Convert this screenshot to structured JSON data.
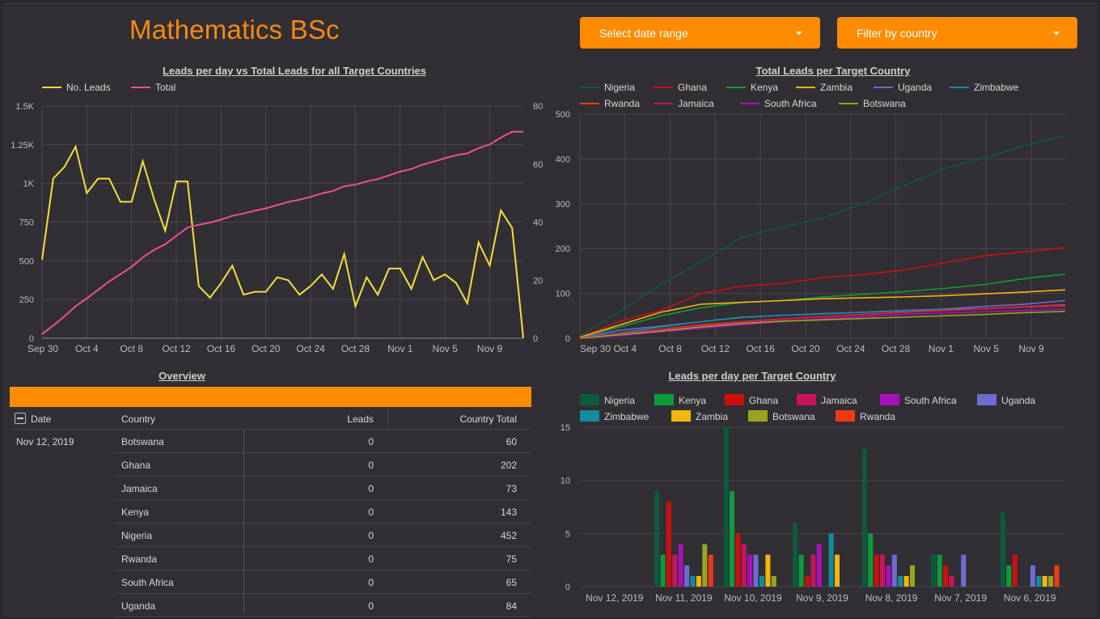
{
  "header": {
    "title": "Mathematics BSc"
  },
  "filters": {
    "date_range_label": "Select date range",
    "country_label": "Filter by country"
  },
  "colors": {
    "accent": "#ff8c00",
    "title": "#f58a12",
    "Nigeria": "#0b5b3f",
    "Ghana": "#cc1010",
    "Kenya": "#0e9b3a",
    "Zambia": "#f5b50f",
    "Uganda": "#6e6cd1",
    "Zimbabwe": "#138c9f",
    "Rwanda": "#f03a17",
    "Jamaica": "#c8145e",
    "South Africa": "#a513b8",
    "Botswana": "#9aa51e",
    "no_leads": "#f6de3b",
    "total": "#ef4f8f"
  },
  "chart_data": [
    {
      "type": "line",
      "title": "Leads per day vs Total Leads for all Target Countries",
      "x_tick_labels": [
        "Sep 30",
        "Oct 4",
        "Oct 8",
        "Oct 12",
        "Oct 16",
        "Oct 20",
        "Oct 24",
        "Oct 28",
        "Nov 1",
        "Nov 5",
        "Nov 9"
      ],
      "left_axis": {
        "ticks": [
          "0",
          "250",
          "500",
          "750",
          "1K",
          "1.25K",
          "1.5K"
        ],
        "range": [
          0,
          1500
        ]
      },
      "right_axis": {
        "ticks": [
          "0",
          "20",
          "40",
          "60",
          "80"
        ],
        "range": [
          0,
          80
        ]
      },
      "series": [
        {
          "name": "No. Leads",
          "axis": "right",
          "values": [
            27,
            55,
            59,
            66,
            50,
            55,
            55,
            47,
            47,
            61,
            48,
            37,
            54,
            54,
            18,
            14,
            19,
            25,
            15,
            16,
            16,
            21,
            20,
            15,
            18,
            22,
            17,
            29,
            11,
            21,
            15,
            24,
            24,
            17,
            28,
            20,
            22,
            19,
            12,
            33,
            25,
            44,
            38,
            0
          ]
        },
        {
          "name": "Total",
          "axis": "left",
          "values": [
            27,
            82,
            141,
            207,
            257,
            312,
            367,
            414,
            461,
            522,
            570,
            607,
            661,
            715,
            733,
            747,
            766,
            791,
            806,
            823,
            839,
            860,
            880,
            895,
            913,
            935,
            952,
            981,
            992,
            1013,
            1028,
            1052,
            1076,
            1093,
            1121,
            1141,
            1163,
            1182,
            1194,
            1227,
            1252,
            1296,
            1334,
            1334
          ]
        }
      ]
    },
    {
      "type": "line",
      "title": "Total Leads per Target Country",
      "x_tick_labels": [
        "Sep 30",
        "Oct 4",
        "Oct 8",
        "Oct 12",
        "Oct 16",
        "Oct 20",
        "Oct 24",
        "Oct 28",
        "Nov 1",
        "Nov 5",
        "Nov 9"
      ],
      "y_ticks": [
        "0",
        "100",
        "200",
        "300",
        "400",
        "500"
      ],
      "ylim": [
        0,
        500
      ],
      "legend": [
        "Nigeria",
        "Ghana",
        "Kenya",
        "Zambia",
        "Uganda",
        "Zimbabwe",
        "Rwanda",
        "Jamaica",
        "South Africa",
        "Botswana"
      ],
      "series": [
        {
          "name": "Nigeria",
          "values": [
            5,
            60,
            120,
            170,
            225,
            248,
            268,
            300,
            340,
            378,
            402,
            430,
            452
          ]
        },
        {
          "name": "Ghana",
          "values": [
            2,
            38,
            62,
            100,
            116,
            122,
            135,
            142,
            152,
            168,
            184,
            193,
            202
          ]
        },
        {
          "name": "Kenya",
          "values": [
            3,
            25,
            50,
            68,
            80,
            84,
            92,
            98,
            104,
            111,
            120,
            133,
            143
          ]
        },
        {
          "name": "Zambia",
          "values": [
            2,
            30,
            58,
            76,
            80,
            84,
            88,
            90,
            92,
            95,
            99,
            103,
            108
          ]
        },
        {
          "name": "Uganda",
          "values": [
            1,
            18,
            27,
            37,
            47,
            51,
            55,
            58,
            62,
            65,
            71,
            76,
            84
          ]
        },
        {
          "name": "Zimbabwe",
          "values": [
            1,
            12,
            25,
            37,
            46,
            51,
            54,
            58,
            61,
            64,
            66,
            69,
            72
          ]
        },
        {
          "name": "Rwanda",
          "values": [
            1,
            10,
            20,
            30,
            37,
            43,
            48,
            53,
            58,
            62,
            66,
            70,
            75
          ]
        },
        {
          "name": "Jamaica",
          "values": [
            1,
            10,
            19,
            28,
            36,
            42,
            47,
            52,
            57,
            61,
            65,
            69,
            73
          ]
        },
        {
          "name": "South Africa",
          "values": [
            0,
            6,
            14,
            22,
            30,
            37,
            43,
            48,
            53,
            56,
            59,
            62,
            65
          ]
        },
        {
          "name": "Botswana",
          "values": [
            0,
            8,
            16,
            25,
            33,
            38,
            41,
            44,
            47,
            50,
            53,
            57,
            60
          ]
        }
      ]
    },
    {
      "type": "bar",
      "title": "Leads per day per Target Country",
      "categories": [
        "Nov 12, 2019",
        "Nov 11, 2019",
        "Nov 10, 2019",
        "Nov 9, 2019",
        "Nov 8, 2019",
        "Nov 7, 2019",
        "Nov 6, 2019"
      ],
      "y_ticks": [
        "0",
        "5",
        "10",
        "15"
      ],
      "ylim": [
        0,
        15
      ],
      "series": [
        {
          "name": "Nigeria",
          "values": [
            0,
            9,
            15,
            6,
            13,
            3,
            7
          ]
        },
        {
          "name": "Kenya",
          "values": [
            0,
            3,
            9,
            3,
            5,
            3,
            2
          ]
        },
        {
          "name": "Ghana",
          "values": [
            0,
            8,
            5,
            1,
            3,
            2,
            3
          ]
        },
        {
          "name": "Jamaica",
          "values": [
            0,
            3,
            4,
            3,
            3,
            1,
            0
          ]
        },
        {
          "name": "South Africa",
          "values": [
            0,
            4,
            3,
            4,
            2,
            0,
            0
          ]
        },
        {
          "name": "Uganda",
          "values": [
            0,
            2,
            3,
            0,
            3,
            3,
            2
          ]
        },
        {
          "name": "Zimbabwe",
          "values": [
            0,
            1,
            1,
            5,
            1,
            0,
            1
          ]
        },
        {
          "name": "Zambia",
          "values": [
            0,
            1,
            3,
            3,
            1,
            0,
            1
          ]
        },
        {
          "name": "Botswana",
          "values": [
            0,
            4,
            1,
            0,
            2,
            0,
            1
          ]
        },
        {
          "name": "Rwanda",
          "values": [
            0,
            3,
            0,
            0,
            0,
            0,
            2
          ]
        }
      ]
    }
  ],
  "overview": {
    "title": "Overview",
    "columns": {
      "date": "Date",
      "country": "Country",
      "leads": "Leads",
      "total": "Country Total"
    },
    "date": "Nov 12, 2019",
    "rows": [
      {
        "country": "Botswana",
        "leads": "0",
        "total": "60"
      },
      {
        "country": "Ghana",
        "leads": "0",
        "total": "202"
      },
      {
        "country": "Jamaica",
        "leads": "0",
        "total": "73"
      },
      {
        "country": "Kenya",
        "leads": "0",
        "total": "143"
      },
      {
        "country": "Nigeria",
        "leads": "0",
        "total": "452"
      },
      {
        "country": "Rwanda",
        "leads": "0",
        "total": "75"
      },
      {
        "country": "South Africa",
        "leads": "0",
        "total": "65"
      },
      {
        "country": "Uganda",
        "leads": "0",
        "total": "84"
      }
    ]
  }
}
